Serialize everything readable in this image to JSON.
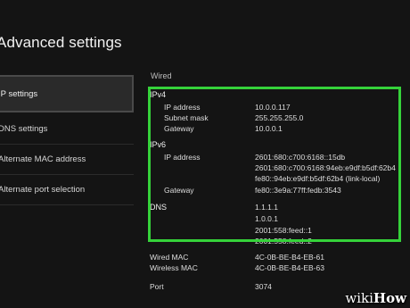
{
  "page_title": "Advanced settings",
  "sidebar": {
    "items": [
      {
        "label": "IP settings"
      },
      {
        "label": "DNS settings"
      },
      {
        "label": "Alternate MAC address"
      },
      {
        "label": "Alternate port selection"
      }
    ]
  },
  "details": {
    "connection_type": "Wired",
    "ipv4": {
      "heading": "IPv4",
      "ip_label": "IP address",
      "ip_value": "10.0.0.117",
      "subnet_label": "Subnet mask",
      "subnet_value": "255.255.255.0",
      "gateway_label": "Gateway",
      "gateway_value": "10.0.0.1"
    },
    "ipv6": {
      "heading": "IPv6",
      "ip_label": "IP address",
      "ip_values": [
        "2601:680:c700:6168::15db",
        "2601:680:c700:6168:94eb:e9df:b5df:62b4",
        "fe80::94eb:e9df:b5df:62b4 (link-local)"
      ],
      "gateway_label": "Gateway",
      "gateway_value": "fe80::3e9a:77ff:fedb:3543"
    },
    "dns": {
      "heading": "DNS",
      "values": [
        "1.1.1.1",
        "1.0.0.1",
        "2001:558:feed::1",
        "2001:558:feed::2"
      ]
    },
    "wired_mac_label": "Wired MAC",
    "wired_mac_value": "4C-0B-BE-B4-EB-61",
    "wireless_mac_label": "Wireless MAC",
    "wireless_mac_value": "4C-0B-BE-B4-EB-63",
    "port_label": "Port",
    "port_value": "3074"
  },
  "watermark": {
    "part1": "wiki",
    "part2": "How"
  },
  "colors": {
    "highlight": "#35d23a",
    "background": "#141414",
    "selected_item": "#2a2a2a"
  }
}
